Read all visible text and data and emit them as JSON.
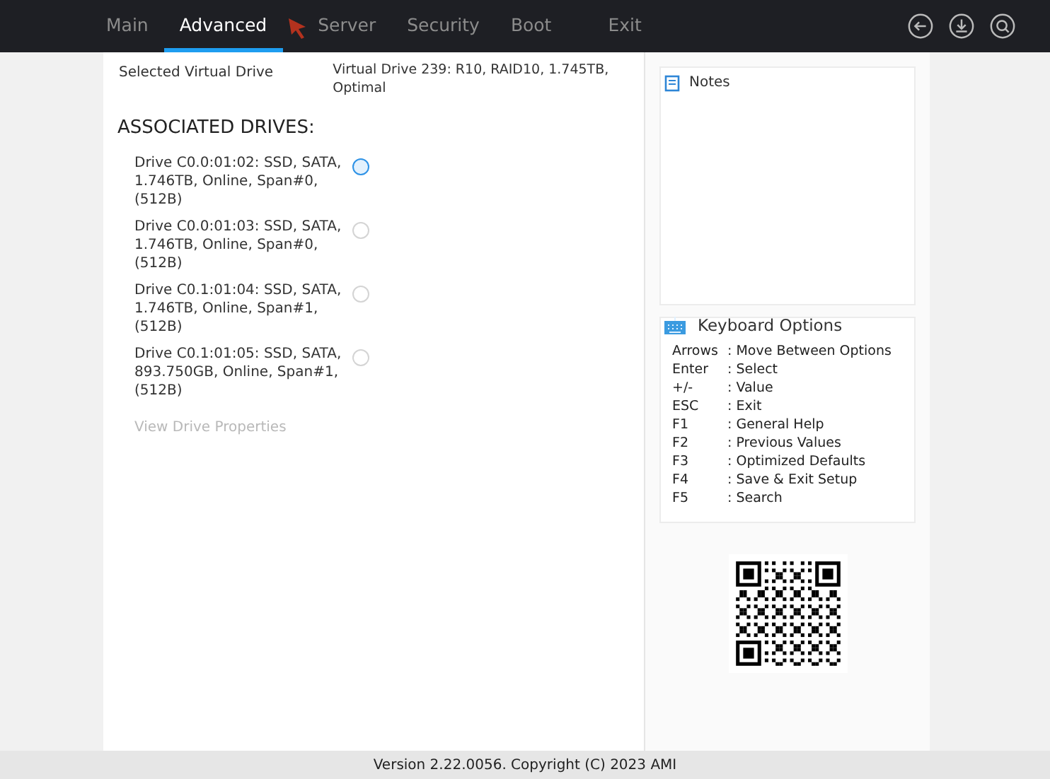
{
  "tabs": [
    {
      "label": "Main",
      "selected": false
    },
    {
      "label": "Advanced",
      "selected": true
    },
    {
      "label": "Server",
      "selected": false
    },
    {
      "label": "Security",
      "selected": false
    },
    {
      "label": "Boot",
      "selected": false
    },
    {
      "label": "Exit",
      "selected": false
    }
  ],
  "selected_virtual_drive": {
    "label": "Selected Virtual Drive",
    "value": "Virtual Drive 239: R10, RAID10, 1.745TB, Optimal"
  },
  "associated_drives": {
    "heading": "ASSOCIATED DRIVES:",
    "drives": [
      {
        "label": "Drive C0.0:01:02: SSD, SATA, 1.746TB, Online, Span#0, (512B)",
        "focused": true
      },
      {
        "label": "Drive C0.0:01:03: SSD, SATA, 1.746TB, Online, Span#0, (512B)",
        "focused": false
      },
      {
        "label": "Drive C0.1:01:04: SSD, SATA, 1.746TB, Online, Span#1, (512B)",
        "focused": false
      },
      {
        "label": "Drive C0.1:01:05: SSD, SATA, 893.750GB, Online, Span#1, (512B)",
        "focused": false
      }
    ]
  },
  "view_drive_properties": {
    "label": "View Drive Properties",
    "disabled": true
  },
  "notes": {
    "title": "Notes"
  },
  "keyboard_options": {
    "title": "Keyboard Options",
    "items": [
      {
        "key": "Arrows",
        "action": ": Move Between Options"
      },
      {
        "key": "Enter",
        "action": ": Select"
      },
      {
        "key": "+/-",
        "action": ": Value"
      },
      {
        "key": "ESC",
        "action": ": Exit"
      },
      {
        "key": "F1",
        "action": ": General Help"
      },
      {
        "key": "F2",
        "action": ": Previous Values"
      },
      {
        "key": "F3",
        "action": ": Optimized Defaults"
      },
      {
        "key": "F4",
        "action": ": Save & Exit Setup"
      },
      {
        "key": "F5",
        "action": ": Search"
      }
    ]
  },
  "status_bar": "Version 2.22.0056. Copyright (C) 2023 AMI"
}
